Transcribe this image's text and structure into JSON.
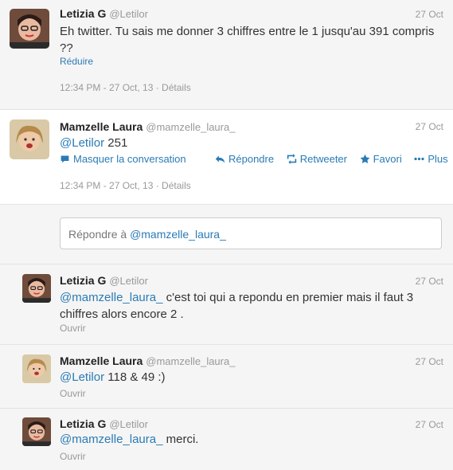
{
  "tweets": [
    {
      "name": "Letizia G",
      "handle": "@Letilor",
      "date": "27 Oct",
      "text_parts": [
        "Eh twitter. Tu sais me donner 3 chiffres entre le 1 jusqu'au 391 compris ??"
      ],
      "link_label": "Réduire",
      "meta": "12:34 PM - 27 Oct, 13 · Détails"
    },
    {
      "name": "Mamzelle Laura",
      "handle": "@mamzelle_laura_",
      "date": "27 Oct",
      "mention": "@Letilor",
      "text": " 251",
      "actions": {
        "hide": "Masquer la conversation",
        "reply": "Répondre",
        "retweet": "Retweeter",
        "favorite": "Favori",
        "more": "Plus"
      },
      "meta": "12:34 PM - 27 Oct, 13 · Détails"
    }
  ],
  "reply_box": {
    "placeholder": "Répondre à @mamzelle_laura_",
    "prefix": "Répondre à ",
    "mention": "@mamzelle_laura_"
  },
  "conversation": [
    {
      "name": "Letizia G",
      "handle": "@Letilor",
      "date": "27 Oct",
      "mention": "@mamzelle_laura_",
      "text": " c'est toi qui a repondu en premier mais il faut 3 chiffres alors encore 2 .",
      "open_label": "Ouvrir"
    },
    {
      "name": "Mamzelle Laura",
      "handle": "@mamzelle_laura_",
      "date": "27 Oct",
      "mention": "@Letilor",
      "text": " 118 & 49 :)",
      "open_label": "Ouvrir"
    },
    {
      "name": "Letizia G",
      "handle": "@Letilor",
      "date": "27 Oct",
      "mention": "@mamzelle_laura_",
      "text": " merci.",
      "open_label": "Ouvrir"
    }
  ],
  "colors": {
    "link": "#2a7bb5",
    "meta": "#999999",
    "background": "#f5f5f5",
    "highlight": "#ffffff"
  }
}
